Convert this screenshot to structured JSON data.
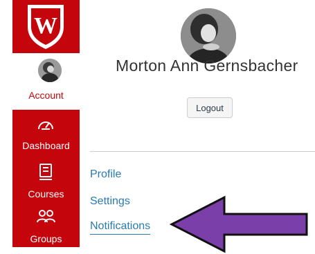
{
  "sidebar": {
    "logo_icon": "uw-crest-logo",
    "items": [
      {
        "label": "Account",
        "icon": "user-avatar"
      },
      {
        "label": "Dashboard",
        "icon": "speedometer-icon"
      },
      {
        "label": "Courses",
        "icon": "book-icon"
      },
      {
        "label": "Groups",
        "icon": "people-icon"
      }
    ],
    "color": "#c5050c"
  },
  "profile": {
    "name": "Morton Ann Gernsbacher",
    "logout_label": "Logout"
  },
  "tray_links": [
    {
      "label": "Profile"
    },
    {
      "label": "Settings"
    },
    {
      "label": "Notifications"
    }
  ],
  "annotation": {
    "icon": "purple-arrow",
    "color": "#7a3fa8"
  }
}
